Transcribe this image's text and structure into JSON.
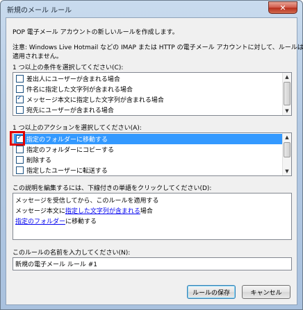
{
  "window": {
    "title": "新規のメール ルール",
    "close_glyph": "✕"
  },
  "intro_text": "POP 電子メール アカウントの新しいルールを作成します。",
  "note_line1": "注意: Windows Live Hotmail などの IMAP または HTTP の電子メール アカウントに対して、ルールは",
  "note_line2": "適用されません。",
  "conditions": {
    "label": "1 つ以上の条件を選択してください(C):",
    "items": [
      {
        "label": "差出人にユーザーが含まれる場合",
        "checked": false
      },
      {
        "label": "件名に指定した文字列が含まれる場合",
        "checked": false
      },
      {
        "label": "メッセージ本文に指定した文字列が含まれる場合",
        "checked": true
      },
      {
        "label": "宛先にユーザーが含まれる場合",
        "checked": false
      }
    ]
  },
  "actions": {
    "label": "1 つ以上のアクションを選択してください(A):",
    "items": [
      {
        "label": "指定のフォルダーに移動する",
        "checked": true
      },
      {
        "label": "指定のフォルダーにコピーする",
        "checked": false
      },
      {
        "label": "削除する",
        "checked": false
      },
      {
        "label": "指定したユーザーに転送する",
        "checked": false
      }
    ]
  },
  "description": {
    "label": "この説明を編集するには、下線付きの単語をクリックしてください(D):",
    "line1": "メッセージを受信してから、このルールを適用する",
    "line2_prefix": "メッセージ本文に",
    "line2_link": "指定した文字列が含まれる",
    "line2_suffix": "場合",
    "line3_link": "指定のフォルダー",
    "line3_suffix": "に移動する"
  },
  "rule_name": {
    "label": "このルールの名前を入力してください(N):",
    "value": "新規の電子メール ルール #1"
  },
  "buttons": {
    "save": "ルールの保存",
    "cancel": "キャンセル"
  },
  "scroll": {
    "up_glyph": "▲",
    "down_glyph": "▼"
  },
  "colors": {
    "selection": "#3399ff",
    "highlight": "#e00000",
    "link": "#0000ee"
  }
}
